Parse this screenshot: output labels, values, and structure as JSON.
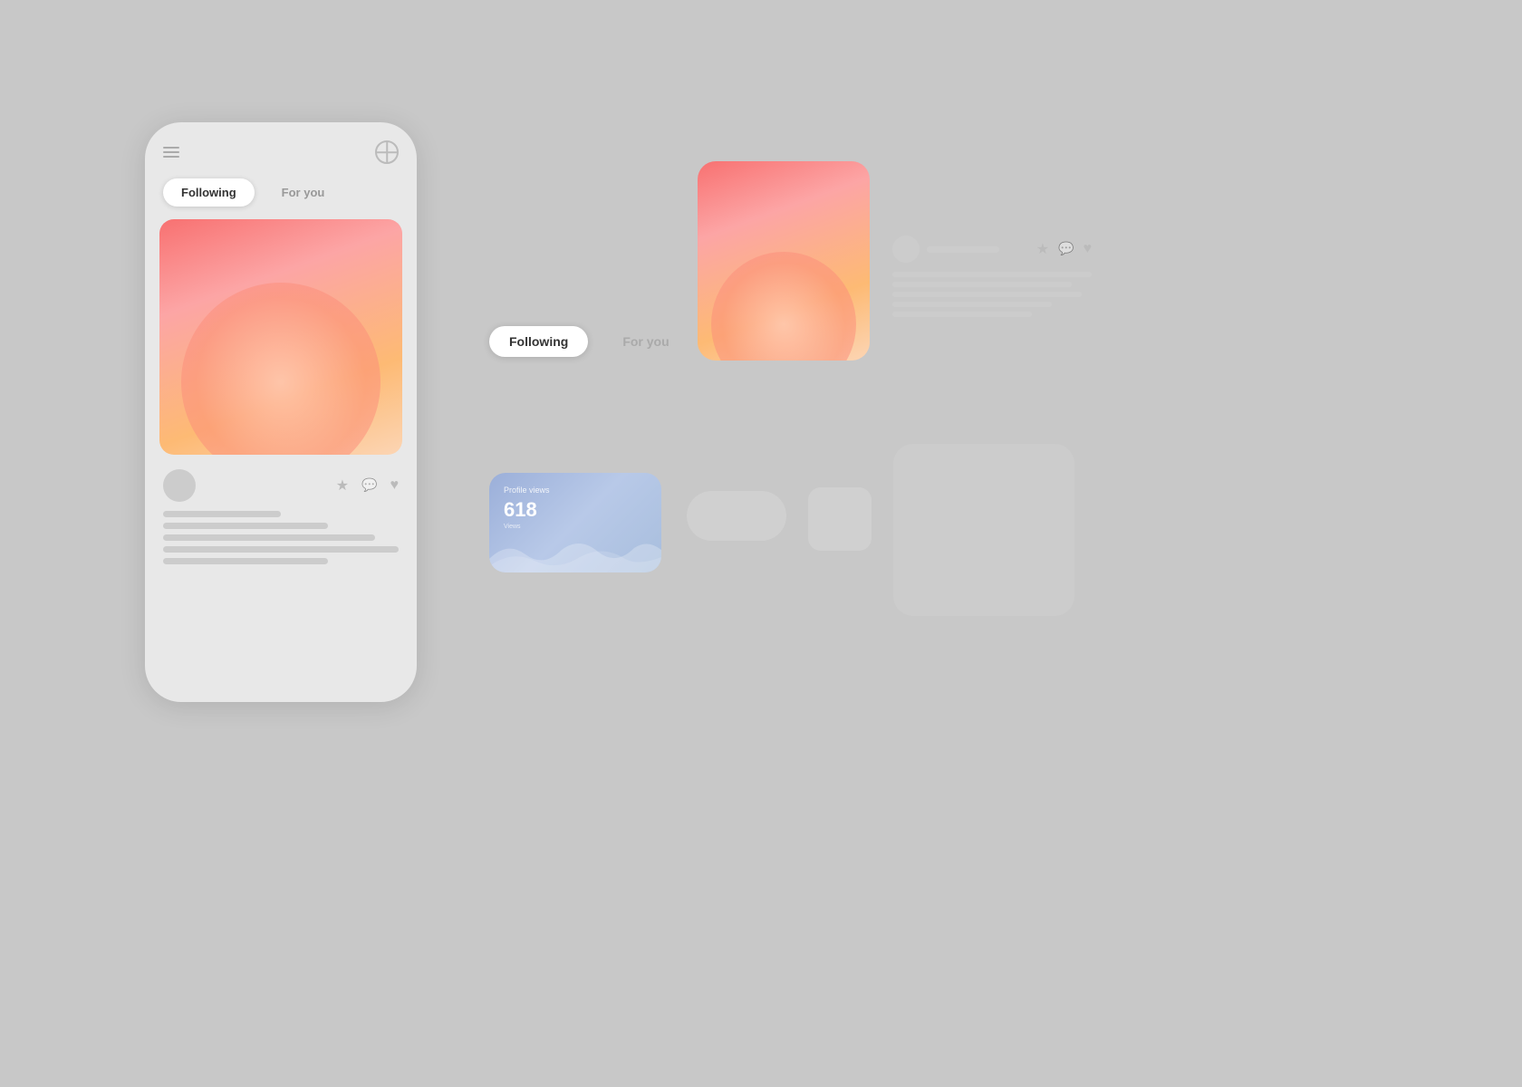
{
  "background": "#c8c8c8",
  "phone": {
    "tab_following": "Following",
    "tab_for_you": "For you",
    "active_tab": "following"
  },
  "standalone_tabs": {
    "tab_following": "Following",
    "tab_for_you": "For you",
    "active_tab": "following"
  },
  "stats_card": {
    "label": "Profile views",
    "value": "618",
    "sublabel": "Views"
  },
  "icons": {
    "star": "★",
    "comment": "▣",
    "heart": "♥",
    "hamburger": "≡",
    "globe": "⊕"
  }
}
